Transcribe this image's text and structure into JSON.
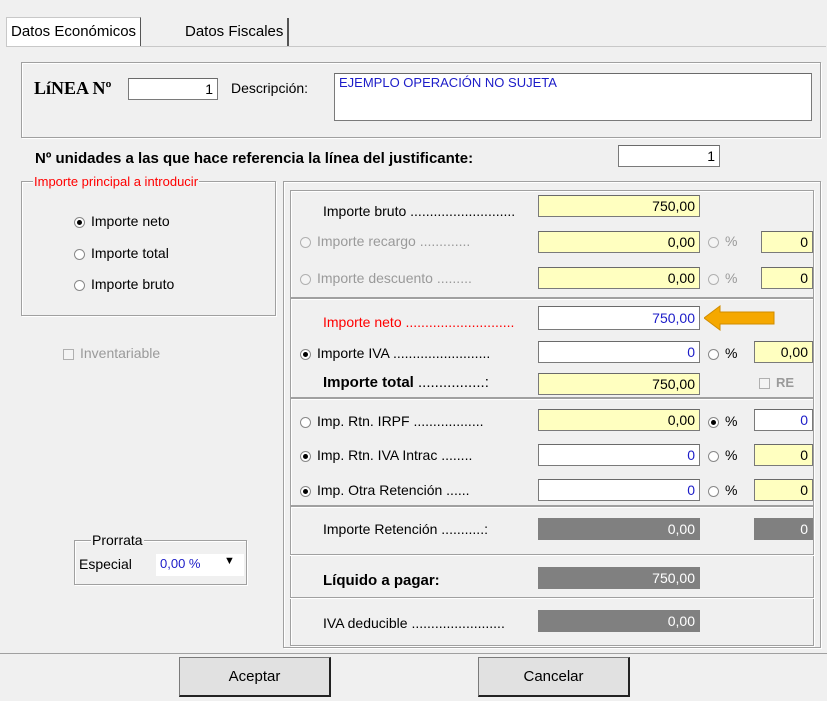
{
  "tabs": [
    {
      "label": "Datos Económicos"
    },
    {
      "label": "Datos Fiscales"
    }
  ],
  "header": {
    "linea_label": "LíNEA Nº",
    "linea_value": "1",
    "descripcion_label": "Descripción:",
    "descripcion_value": "EJEMPLO OPERACIÓN NO SUJETA"
  },
  "unidades": {
    "label": "Nº unidades a las que hace referencia la línea del justificante:",
    "value": "1"
  },
  "importe_principal": {
    "legend": "Importe principal a introducir",
    "options": [
      {
        "label": "Importe neto",
        "selected": true
      },
      {
        "label": "Importe total",
        "selected": false
      },
      {
        "label": "Importe bruto",
        "selected": false
      }
    ]
  },
  "inventariable": {
    "label": "Inventariable",
    "checked": false
  },
  "prorrata": {
    "legend": "Prorrata",
    "label": "Especial",
    "value": "0,00 %"
  },
  "rows": {
    "importe_bruto": {
      "label": "Importe bruto",
      "value": "750,00"
    },
    "importe_recargo": {
      "label": "Importe recargo",
      "value": "0,00",
      "pct_label": "%",
      "pct_value": "0"
    },
    "importe_descuento": {
      "label": "Importe descuento",
      "value": "0,00",
      "pct_label": "%",
      "pct_value": "0"
    },
    "importe_neto": {
      "label": "Importe neto",
      "value": "750,00"
    },
    "importe_iva": {
      "label": "Importe IVA",
      "value": "0",
      "pct_label": "%",
      "pct_value": "0,00"
    },
    "importe_total": {
      "label": "Importe total",
      "value": "750,00",
      "re_label": "RE"
    },
    "rtn_irpf": {
      "label": "Imp. Rtn. IRPF",
      "value": "0,00",
      "pct_label": "%",
      "pct_value": "0"
    },
    "rtn_iva_intrac": {
      "label": "Imp. Rtn. IVA Intrac",
      "value": "0",
      "pct_label": "%",
      "pct_value": "0"
    },
    "otra_retencion": {
      "label": "Imp. Otra Retención",
      "value": "0",
      "pct_label": "%",
      "pct_value": "0"
    },
    "importe_retencion": {
      "label": "Importe Retención",
      "value": "0,00",
      "pct_value": "0"
    },
    "liquido": {
      "label": "Líquido a pagar:",
      "value": "750,00"
    },
    "iva_deducible": {
      "label": "IVA deducible",
      "value": "0,00"
    }
  },
  "buttons": {
    "aceptar": "Aceptar",
    "cancelar": "Cancelar"
  },
  "colors": {
    "accent_red": "#ff0000",
    "arrow": "#f5a800",
    "yellow_field": "#ffffc0"
  }
}
